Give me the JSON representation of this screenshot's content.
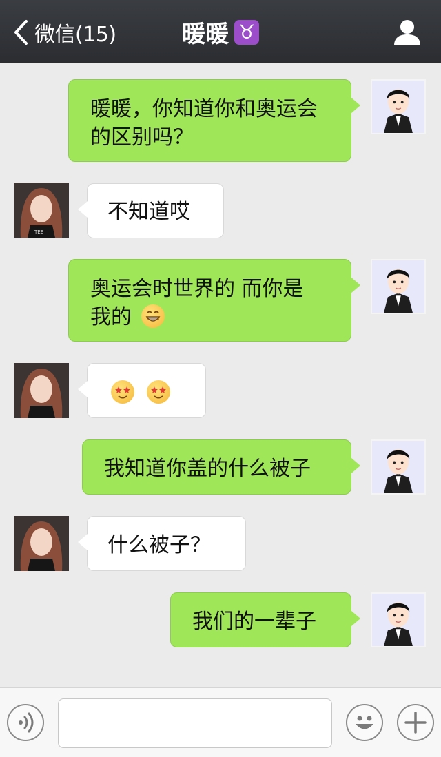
{
  "header": {
    "back_label": "微信(15)",
    "title": "暖暖",
    "zodiac_symbol": "♉",
    "zodiac_color": "#9b4dca"
  },
  "messages": [
    {
      "from": "me",
      "text_line1": "暖暖，你知道你和奥运会",
      "text_line2": "的区别吗？"
    },
    {
      "from": "her",
      "text": "不知道哎"
    },
    {
      "from": "me",
      "text_line1": "奥运会时世界的 而你是",
      "text_line2": "我的",
      "emoji": "grinning-face"
    },
    {
      "from": "her",
      "emoji": "star-struck-face",
      "emoji_count": 2
    },
    {
      "from": "me",
      "text": "我知道你盖的什么被子"
    },
    {
      "from": "her",
      "text": "什么被子？"
    },
    {
      "from": "me",
      "text": "我们的一辈子"
    }
  ],
  "colors": {
    "my_bubble": "#9fe658",
    "her_bubble": "#ffffff",
    "background": "#ebebeb",
    "header": "#2b2d31"
  },
  "bottom_bar": {
    "voice_icon": "voice-icon",
    "emoji_icon": "smiley-icon",
    "more_icon": "plus-icon",
    "input_value": ""
  }
}
